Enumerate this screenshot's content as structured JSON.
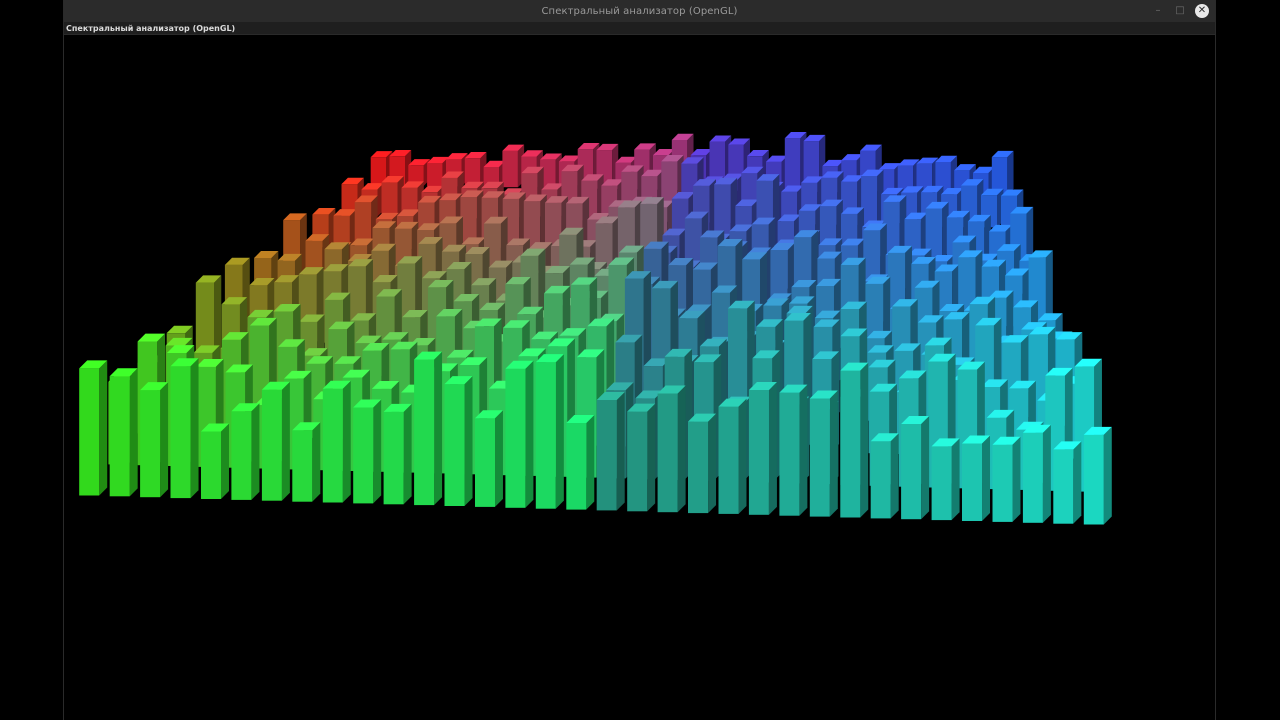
{
  "window": {
    "title": "Спектральный анализатор (OpenGL)",
    "subtitle": "Спектральный анализатор (OpenGL)",
    "controls": {
      "minimize_glyph": "–",
      "maximize_glyph": "□",
      "close_glyph": "✕"
    }
  },
  "visualization": {
    "type": "3d-spectrum-bars",
    "colors": {
      "red": "#ff1a1a",
      "orange": "#c8861a",
      "magenta": "#b03c8c",
      "violet": "#5a3ad0",
      "blue": "#2a66ff",
      "sky": "#2aa8ff",
      "green": "#3cff1e",
      "spring": "#1eff7a",
      "teal": "#2aa890",
      "cyan": "#20ffe6"
    }
  }
}
